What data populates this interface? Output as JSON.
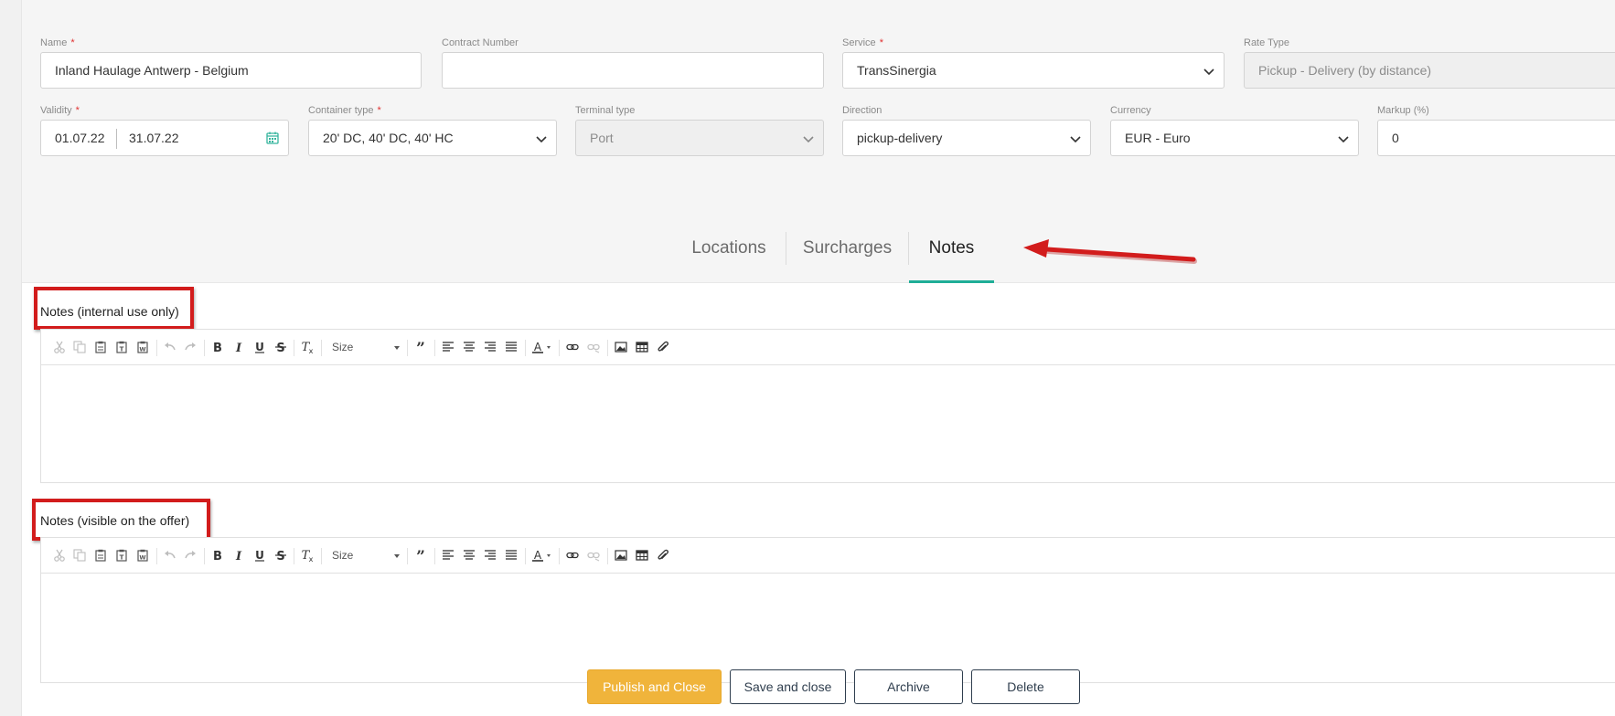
{
  "form": {
    "name": {
      "label": "Name",
      "value": "Inland Haulage Antwerp - Belgium"
    },
    "contract_number": {
      "label": "Contract Number",
      "value": ""
    },
    "service": {
      "label": "Service",
      "value": "TransSinergia"
    },
    "rate_type": {
      "label": "Rate Type",
      "value": "Pickup - Delivery (by distance)"
    },
    "validity": {
      "label": "Validity",
      "from": "01.07.22",
      "to": "31.07.22"
    },
    "container_type": {
      "label": "Container type",
      "value": "20' DC, 40' DC, 40' HC"
    },
    "terminal_type": {
      "label": "Terminal type",
      "value": "Port"
    },
    "direction": {
      "label": "Direction",
      "value": "pickup-delivery"
    },
    "currency": {
      "label": "Currency",
      "value": "EUR - Euro"
    },
    "markup": {
      "label": "Markup (%)",
      "value": "0"
    },
    "required_marker": "*"
  },
  "tabs": [
    {
      "label": "Locations",
      "active": false
    },
    {
      "label": "Surcharges",
      "active": false
    },
    {
      "label": "Notes",
      "active": true
    }
  ],
  "notes": {
    "internal_label": "Notes (internal use only)",
    "offer_label": "Notes (visible on the offer)",
    "toolbar_size_label": "Size"
  },
  "actions": {
    "publish": "Publish and Close",
    "save": "Save and close",
    "archive": "Archive",
    "delete": "Delete"
  },
  "colors": {
    "accent_tab": "#1fae97",
    "primary_button": "#f0b43b",
    "annotation_red": "#d21c1c",
    "required": "#e03131"
  },
  "icons": [
    "cut-icon",
    "copy-icon",
    "paste-icon",
    "paste-text-icon",
    "paste-word-icon",
    "undo-icon",
    "redo-icon",
    "bold-icon",
    "italic-icon",
    "underline-icon",
    "strikethrough-icon",
    "remove-format-icon",
    "blockquote-icon",
    "align-left-icon",
    "align-center-icon",
    "align-right-icon",
    "justify-icon",
    "text-color-icon",
    "link-icon",
    "unlink-icon",
    "image-icon",
    "table-icon",
    "attachment-icon",
    "calendar-icon",
    "chevron-down-icon",
    "red-arrow-annotation"
  ]
}
